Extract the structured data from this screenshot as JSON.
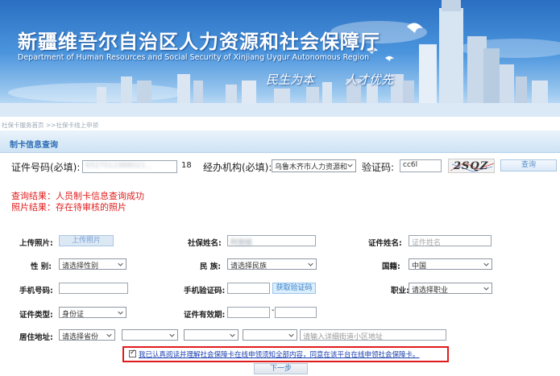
{
  "banner": {
    "title": "新疆维吾尔自治区人力资源和社会保障厅",
    "subtitle": "Department of Human Resources and Social Security of Xinjiang Uygur Autonomous Region",
    "slogan_left": "民生为本",
    "slogan_right": "人才优先"
  },
  "breadcrumb": "社保卡服务首页 >>社保卡线上申领",
  "section": {
    "title": "制卡信息查询"
  },
  "query": {
    "id_label": "证件号码(必填):",
    "id_value": "6527011988021...",
    "id_length": "18",
    "agency_label": "经办机构(必填):",
    "agency_value": "乌鲁木齐市人力资源和",
    "captcha_label": "验证码:",
    "captcha_value": "cc6l",
    "captcha_image_text": "2SQZ",
    "query_button": "查询"
  },
  "results": {
    "query_result": "查询结果：人员制卡信息查询成功",
    "photo_result": "照片结果：存在待审核的照片"
  },
  "form": {
    "upload_label": "上传照片:",
    "upload_button": "上传照片",
    "ss_name_label": "社保姓名:",
    "ss_name_value": "阿丽娅",
    "cert_name_label": "证件姓名:",
    "cert_name_placeholder": "证件姓名",
    "gender_label": "性 别:",
    "gender_value": "请选择性别",
    "ethnicity_label": "民 族:",
    "ethnicity_value": "请选择民族",
    "nationality_label": "国籍:",
    "nationality_value": "中国",
    "phone_label": "手机号码:",
    "sms_label": "手机验证码:",
    "sms_button": "获取验证码",
    "job_label": "职业:",
    "job_value": "请选择职业",
    "cert_type_label": "证件类型:",
    "cert_type_value": "身份证",
    "validity_label": "证件有效期:",
    "validity_separator": "-",
    "address_label": "居住地址:",
    "province_value": "请选择省份",
    "address_placeholder": "请输入详细街道小区地址"
  },
  "agreement": {
    "checked": true,
    "text": "我已认真阅读并理解社会保障卡在线申领须知全部内容，同意在该平台在线申领社会保障卡。"
  },
  "next_button": "下一步",
  "colors": {
    "accent": "#2f6fb5",
    "alert": "#e02020",
    "highlight_border": "#e01b1b"
  }
}
